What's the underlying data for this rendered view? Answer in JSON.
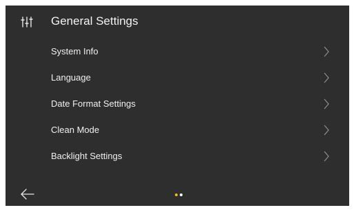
{
  "header": {
    "title": "General Settings",
    "icon": "settings-sliders-icon"
  },
  "menu": {
    "items": [
      {
        "label": "System Info",
        "icon": "chevron-right-icon"
      },
      {
        "label": "Language",
        "icon": "chevron-right-icon"
      },
      {
        "label": "Date Format Settings",
        "icon": "chevron-right-icon"
      },
      {
        "label": "Clean Mode",
        "icon": "chevron-right-icon"
      },
      {
        "label": "Backlight Settings",
        "icon": "chevron-right-icon"
      }
    ]
  },
  "footer": {
    "back_icon": "arrow-left-icon",
    "pager": {
      "page_count": 2,
      "current_page": 1,
      "active_color": "#f5b915",
      "inactive_color": "#ffffff"
    }
  },
  "colors": {
    "background": "#2e2e2e",
    "frame": "#ffffff",
    "text": "#f0f0f0",
    "chevron": "#8a8a8a"
  }
}
